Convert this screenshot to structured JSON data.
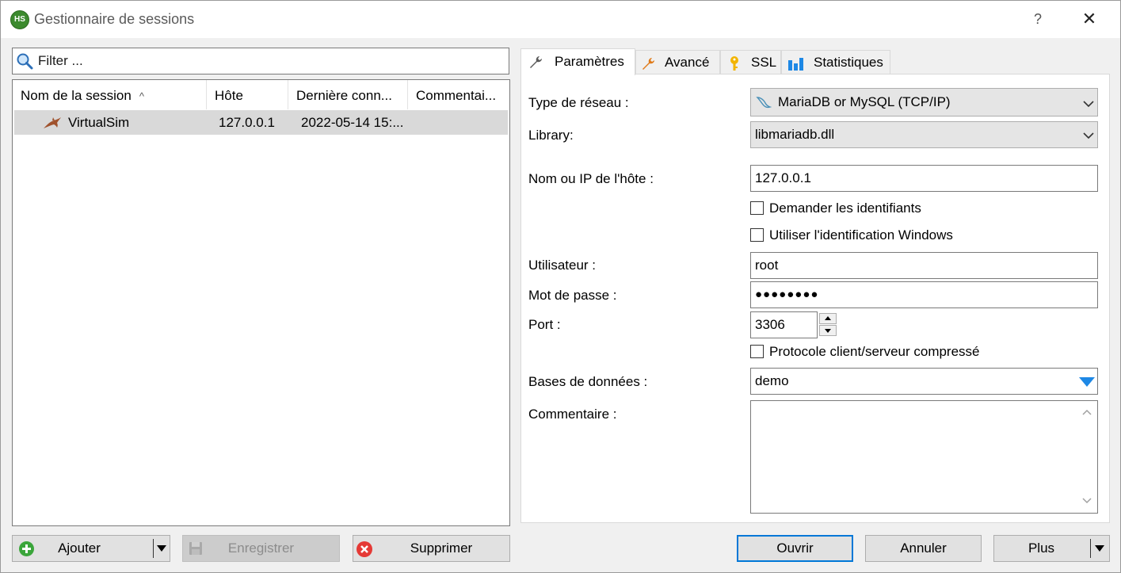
{
  "window": {
    "title": "Gestionnaire de sessions",
    "logo_text": "HS",
    "help_glyph": "?",
    "close_glyph": "✕"
  },
  "filter": {
    "placeholder": "Filter ...",
    "value": ""
  },
  "sessions": {
    "columns": [
      {
        "label": "Nom de la session"
      },
      {
        "label": "Hôte"
      },
      {
        "label": "Dernière conn..."
      },
      {
        "label": "Commentai..."
      }
    ],
    "sort_glyph": "^",
    "rows": [
      {
        "name": "VirtualSim",
        "host": "127.0.0.1",
        "last_connection": "2022-05-14 15:...",
        "comment": "",
        "icon": "dolphin-icon"
      }
    ]
  },
  "left_buttons": {
    "add": "Ajouter",
    "save": "Enregistrer",
    "delete": "Supprimer"
  },
  "tabs": [
    {
      "label": "Paramètres",
      "icon": "wrench-icon",
      "active": true
    },
    {
      "label": "Avancé",
      "icon": "wrench-orange-icon",
      "active": false
    },
    {
      "label": "SSL",
      "icon": "key-icon",
      "active": false
    },
    {
      "label": "Statistiques",
      "icon": "bar-chart-icon",
      "active": false
    }
  ],
  "settings": {
    "network_type_label": "Type de réseau :",
    "network_type_value": "MariaDB or MySQL (TCP/IP)",
    "library_label": "Library:",
    "library_value": "libmariadb.dll",
    "host_label": "Nom ou IP de l'hôte :",
    "host_value": "127.0.0.1",
    "ask_credentials_label": "Demander les identifiants",
    "ask_credentials_checked": false,
    "windows_auth_label": "Utiliser l'identification Windows",
    "windows_auth_checked": false,
    "user_label": "Utilisateur :",
    "user_value": "root",
    "password_label": "Mot de passe :",
    "password_value": "●●●●●●●●",
    "port_label": "Port :",
    "port_value": "3306",
    "compressed_label": "Protocole client/serveur compressé",
    "compressed_checked": false,
    "databases_label": "Bases de données :",
    "databases_value": "demo",
    "comment_label": "Commentaire :",
    "comment_value": ""
  },
  "right_buttons": {
    "open": "Ouvrir",
    "cancel": "Annuler",
    "more": "Plus"
  },
  "colors": {
    "accent_focus": "#0078d7",
    "selected_row": "#d9d9d9",
    "dropdown_blue": "#1e88e5"
  }
}
